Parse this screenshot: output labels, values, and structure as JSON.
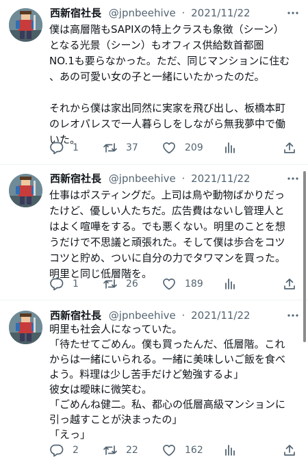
{
  "tweets": [
    {
      "author": "西新宿社長",
      "handle": "@jpnbeehive",
      "sep": "·",
      "date": "2021/11/22",
      "lines": [
        "僕は高層階もSAPIXの特上クラスも象徴（シーン）",
        "となる光景（シーン）もオフィス供給数首都圏",
        "NO.1も要らなかった。ただ、同じマンションに住む",
        "、あの可愛い女の子と一緒にいたかったのだ。",
        "",
        "それから僕は家出同然に実家を飛び出し、板橋本町",
        "のレオパレスで一人暮らしをしながら無我夢中で働",
        "いた。"
      ],
      "replies": "1",
      "retweets": "37",
      "likes": "209"
    },
    {
      "author": "西新宿社長",
      "handle": "@jpnbeehive",
      "sep": "·",
      "date": "2021/11/22",
      "lines": [
        "仕事はポスティングだ。上司は鳥や動物ばかりだっ",
        "たけど、優しい人たちだ。広告費はないし管理人と",
        "はよく喧嘩をする。でも悪くない。明里のことを想",
        "うだけで不思議と頑張れた。そして僕は歩合をコツ",
        "コツと貯め、ついに自分の力でタワマンを買った。",
        "明里と同じ低層階を。"
      ],
      "replies": "1",
      "retweets": "26",
      "likes": "189"
    },
    {
      "author": "西新宿社長",
      "handle": "@jpnbeehive",
      "sep": "·",
      "date": "2021/11/22",
      "lines": [
        "明里も社会人になっていた。",
        "「待たせてごめん。僕も買ったんだ、低層階。これ",
        "からは一緒にいられる。一緒に美味しいご飯を食べ",
        "よう。料理は少し苦手だけど勉強するよ」",
        "彼女は曖昧に微笑む。",
        "「ごめんね健二。私、都心の低層高級マンションに",
        "引っ越すことが決まったの」",
        "「えっ」"
      ],
      "replies": "2",
      "retweets": "22",
      "likes": "162"
    }
  ],
  "icons": {
    "more": "more-icon",
    "reply": "reply-icon",
    "retweet": "retweet-icon",
    "like": "like-icon",
    "analytics": "analytics-icon",
    "share": "share-icon",
    "avatar": "avatar"
  },
  "colors": {
    "text": "#0f1419",
    "secondary": "#536471",
    "divider": "#eff3f4"
  }
}
